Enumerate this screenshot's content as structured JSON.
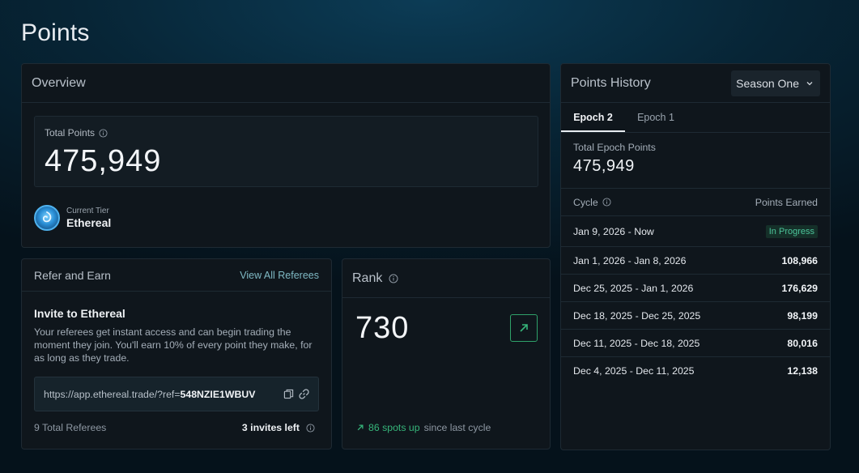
{
  "page": {
    "title": "Points"
  },
  "overview": {
    "title": "Overview",
    "total_points_label": "Total Points",
    "total_points_value": "475,949",
    "tier_label": "Current Tier",
    "tier_name": "Ethereal"
  },
  "refer": {
    "title": "Refer and Earn",
    "view_all_label": "View All Referees",
    "invite_title": "Invite to Ethereal",
    "invite_desc": "Your referees get instant access and can begin trading the moment they join. You'll earn 10% of every point they make, for as long as they trade.",
    "link_prefix": "https://app.ethereal.trade/?ref=",
    "link_code": "548NZIE1WBUV",
    "total_referees": "9 Total Referees",
    "invites_left": "3 invites left"
  },
  "rank": {
    "title": "Rank",
    "value": "730",
    "spots_up": "86 spots up",
    "since_text": "since last cycle"
  },
  "history": {
    "title": "Points History",
    "season": "Season One",
    "tabs": [
      {
        "label": "Epoch 2"
      },
      {
        "label": "Epoch 1"
      }
    ],
    "epoch_points_label": "Total Epoch Points",
    "epoch_points_value": "475,949",
    "col_cycle": "Cycle",
    "col_points": "Points Earned",
    "rows": [
      {
        "cycle": "Jan 9, 2026 - Now",
        "points": "In Progress"
      },
      {
        "cycle": "Jan 1, 2026 - Jan 8, 2026",
        "points": "108,966"
      },
      {
        "cycle": "Dec 25, 2025 - Jan 1, 2026",
        "points": "176,629"
      },
      {
        "cycle": "Dec 18, 2025 - Dec 25, 2025",
        "points": "98,199"
      },
      {
        "cycle": "Dec 11, 2025 - Dec 18, 2025",
        "points": "80,016"
      },
      {
        "cycle": "Dec 4, 2025 - Dec 11, 2025",
        "points": "12,138"
      }
    ]
  },
  "colors": {
    "accent_teal": "#7fb9c4",
    "positive_green": "#36b57a",
    "card_bg": "#0f161c"
  },
  "icons": [
    "info-icon",
    "tier-badge-icon",
    "copy-icon",
    "link-icon",
    "arrow-up-right-icon",
    "chevron-down-icon"
  ]
}
